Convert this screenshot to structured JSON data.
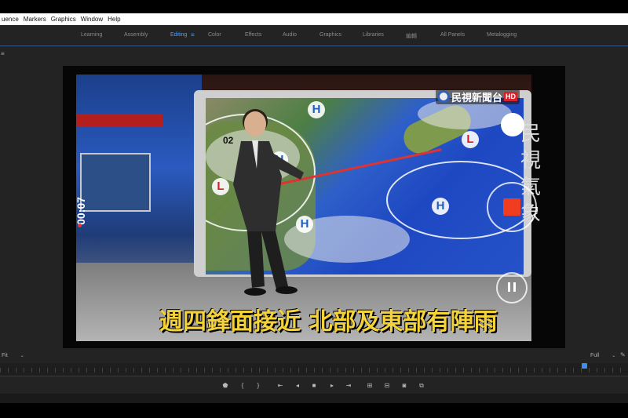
{
  "menu": [
    "uence",
    "Markers",
    "Graphics",
    "Window",
    "Help"
  ],
  "workspaces": [
    {
      "label": "Learning",
      "active": false
    },
    {
      "label": "Assembly",
      "active": false
    },
    {
      "label": "Editing",
      "active": true
    },
    {
      "label": "Color",
      "active": false
    },
    {
      "label": "Effects",
      "active": false
    },
    {
      "label": "Audio",
      "active": false
    },
    {
      "label": "Graphics",
      "active": false
    },
    {
      "label": "Libraries",
      "active": false
    },
    {
      "label": "編輯",
      "active": false
    },
    {
      "label": "All Panels",
      "active": false
    },
    {
      "label": "Metalogging",
      "active": false
    }
  ],
  "workspace_menu_icon": "hamburger-icon",
  "panel_menu_icon": "hamburger-icon",
  "video": {
    "channel_logo": "民視新聞台",
    "channel_hd": "HD",
    "vertical_logo": [
      "民",
      "視",
      "氣",
      "象"
    ],
    "map_labels": {
      "h": "H",
      "l": "L",
      "time": "02"
    },
    "caption": "週四鋒面接近 北部及東部有陣雨",
    "recording_timer": "00:07",
    "recording_indicator_color": "#e33333",
    "record_button_color": "#f03c1f"
  },
  "monitor": {
    "zoom_fit": "Fit",
    "resolution": "Full"
  },
  "accent_color": "#4f9fff",
  "transport_icons": [
    "add-marker-icon",
    "mark-in-icon",
    "mark-out-icon",
    "go-to-in-icon",
    "step-back-icon",
    "stop-icon",
    "step-forward-icon",
    "go-to-out-icon",
    "insert-icon",
    "overwrite-icon",
    "export-frame-icon",
    "compare-icon"
  ]
}
